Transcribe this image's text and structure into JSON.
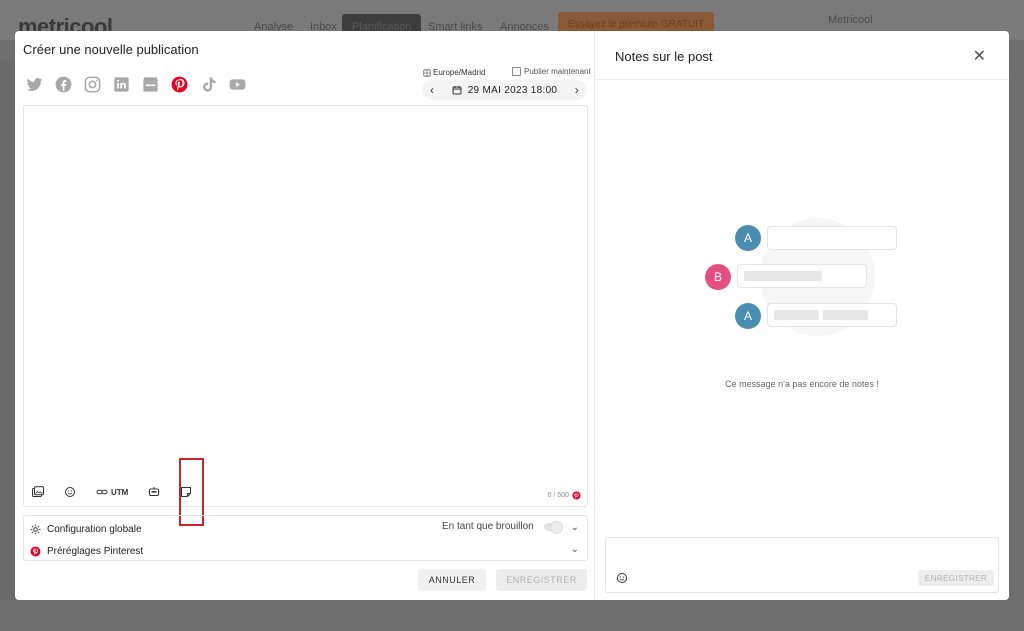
{
  "background": {
    "logo": "metricool",
    "nav": [
      "Analyse",
      "Inbox",
      "Planification",
      "Smart links",
      "Annonces"
    ],
    "cta": "Essayez le premium GRATUIT",
    "user": "Metricool"
  },
  "composer": {
    "title": "Créer une nouvelle publication",
    "networks": [
      "twitter",
      "facebook",
      "instagram",
      "linkedin",
      "google-business",
      "pinterest",
      "tiktok",
      "youtube"
    ],
    "timezone": "Europe/Madrid",
    "publish_now": "Publier maintenant",
    "date": "29 MAI 2023 18:00",
    "toolbar": {
      "utm": "UTM"
    },
    "counter": "0 / 500",
    "config_label": "Configuration globale",
    "draft_label": "En tant que brouillon",
    "pinterest_presets": "Préréglages Pinterest",
    "cancel": "ANNULER",
    "save": "ENREGISTRER"
  },
  "notes": {
    "title": "Notes sur le post",
    "avatars": [
      "A",
      "B",
      "A"
    ],
    "empty": "Ce message n'a pas encore de notes !",
    "save": "ENREGISTRER"
  },
  "colors": {
    "pinterest": "#e60023",
    "avatar_a": "#4a8db0",
    "avatar_b": "#e24f80",
    "highlight": "#c0282d"
  }
}
